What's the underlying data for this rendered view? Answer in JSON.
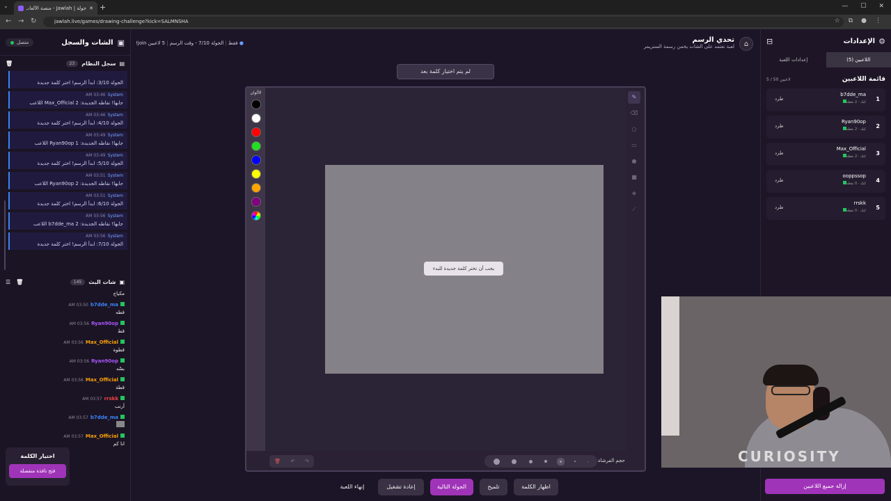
{
  "browser": {
    "tab_title": "جولة | Jawlah - منصة الألعاب الـ",
    "url": "jawlah.live/games/drawing-challenge?kick=SALMNSHA"
  },
  "left_panel": {
    "title": "الشات والسجل",
    "online_label": "متصل",
    "system_log": {
      "title": "سجل النظام",
      "count": "23",
      "entries": [
        {
          "meta": "",
          "sender": "",
          "text": "الجولة 3/10: ابدأ الرسم! اختر كلمة جديدة"
        },
        {
          "meta": "AM 03:46",
          "sender": "System",
          "text": "اللاعب Max_Official جابها! نقاطه الجديدة: 2"
        },
        {
          "meta": "AM 03:46",
          "sender": "System",
          "text": "الجولة 4/10: ابدأ الرسم! اختر كلمة جديدة"
        },
        {
          "meta": "AM 03:49",
          "sender": "System",
          "text": "اللاعب Ryan90op جابها! نقاطه الجديدة: 1"
        },
        {
          "meta": "AM 03:49",
          "sender": "System",
          "text": "الجولة 5/10: ابدأ الرسم! اختر كلمة جديدة"
        },
        {
          "meta": "AM 03:51",
          "sender": "System",
          "text": "اللاعب Ryan90op جابها! نقاطه الجديدة: 2"
        },
        {
          "meta": "AM 03:51",
          "sender": "System",
          "text": "الجولة 6/10: ابدأ الرسم! اختر كلمة جديدة"
        },
        {
          "meta": "AM 03:56",
          "sender": "System",
          "text": "اللاعب b7dde_ma جابها! نقاطه الجديدة: 2"
        },
        {
          "meta": "AM 03:56",
          "sender": "System",
          "text": "الجولة 7/10: ابدأ الرسم! اختر كلمة جديدة"
        }
      ]
    },
    "stream_chat": {
      "title": "شات البث",
      "count": "145",
      "messages": [
        {
          "user": "",
          "time": "",
          "color": "#e6e0ee",
          "text": "مكياج"
        },
        {
          "user": "b7dde_ma",
          "time": "AM 03:50",
          "color": "#3b82f6",
          "text": "قطه"
        },
        {
          "user": "Ryan90op",
          "time": "AM 03:56",
          "color": "#a855f7",
          "text": "قط"
        },
        {
          "user": "Max_Official",
          "time": "AM 03:56",
          "color": "#f59e0b",
          "text": "قطوة"
        },
        {
          "user": "Ryan90op",
          "time": "AM 03:56",
          "color": "#a855f7",
          "text": "بسّه"
        },
        {
          "user": "Max_Official",
          "time": "AM 03:56",
          "color": "#f59e0b",
          "text": "قطة"
        },
        {
          "user": "rrskk",
          "time": "AM 03:57",
          "color": "#ef4444",
          "text": "أرنب"
        },
        {
          "user": "b7dde_ma",
          "time": "AM 03:57",
          "color": "#3b82f6",
          "text": ""
        },
        {
          "user": "Max_Official",
          "time": "AM 03:57",
          "color": "#f59e0b",
          "text": "انا كم"
        }
      ]
    },
    "word_choice": {
      "title": "اختيار الكلمة",
      "button": "فتح نافذة منفصلة"
    }
  },
  "game": {
    "title": "تحدي الرسم",
    "subtitle": "لعبة تعتمد على الشات يخمن رسمة الستريمر",
    "players_info": "5 لاعبين",
    "round_info": "الجولة 7/10 - وقت الرسم",
    "join_info": "!join فقط",
    "notice": "لم يتم اختيار كلمة بعد",
    "palette_label": "الألوان",
    "colors": [
      "#000000",
      "#ffffff",
      "#ff0000",
      "#22dd22",
      "#0000ff",
      "#ffff00",
      "#ffa500",
      "#800080"
    ],
    "prompt": "يجب أن تختر كلمة جديدة للبدء",
    "brush_size_label": "حجم الفرشاة",
    "actions": {
      "end_game": "إنهاء اللعبة",
      "restart": "إعادة تشغيل",
      "next_round": "الجولة التالية",
      "hint": "تلميح",
      "show_word": "اظهار الكلمة"
    }
  },
  "right_panel": {
    "title": "الإعدادات",
    "tabs": [
      "اللاعبين (5)",
      "إعدادات اللعبة"
    ],
    "list_title": "قائمة اللاعبين",
    "list_count": "5 / 50 لاعبين",
    "kick_label": "طرد",
    "players": [
      {
        "rank": "1",
        "name": "b7dde_ma",
        "score": "كيك · 2 نقطة"
      },
      {
        "rank": "2",
        "name": "Ryan90op",
        "score": "كيك · 2 نقطة"
      },
      {
        "rank": "3",
        "name": "Max_Official",
        "score": "كيك · 2 نقطة"
      },
      {
        "rank": "4",
        "name": "ooppssop",
        "score": "كيك · 0 نقطة"
      },
      {
        "rank": "5",
        "name": "rrskk",
        "score": "كيك · 0 نقطة"
      }
    ],
    "remove_all": "إزالة جميع اللاعبين"
  },
  "webcam": {
    "shirt_text": "CURIOSITY"
  }
}
